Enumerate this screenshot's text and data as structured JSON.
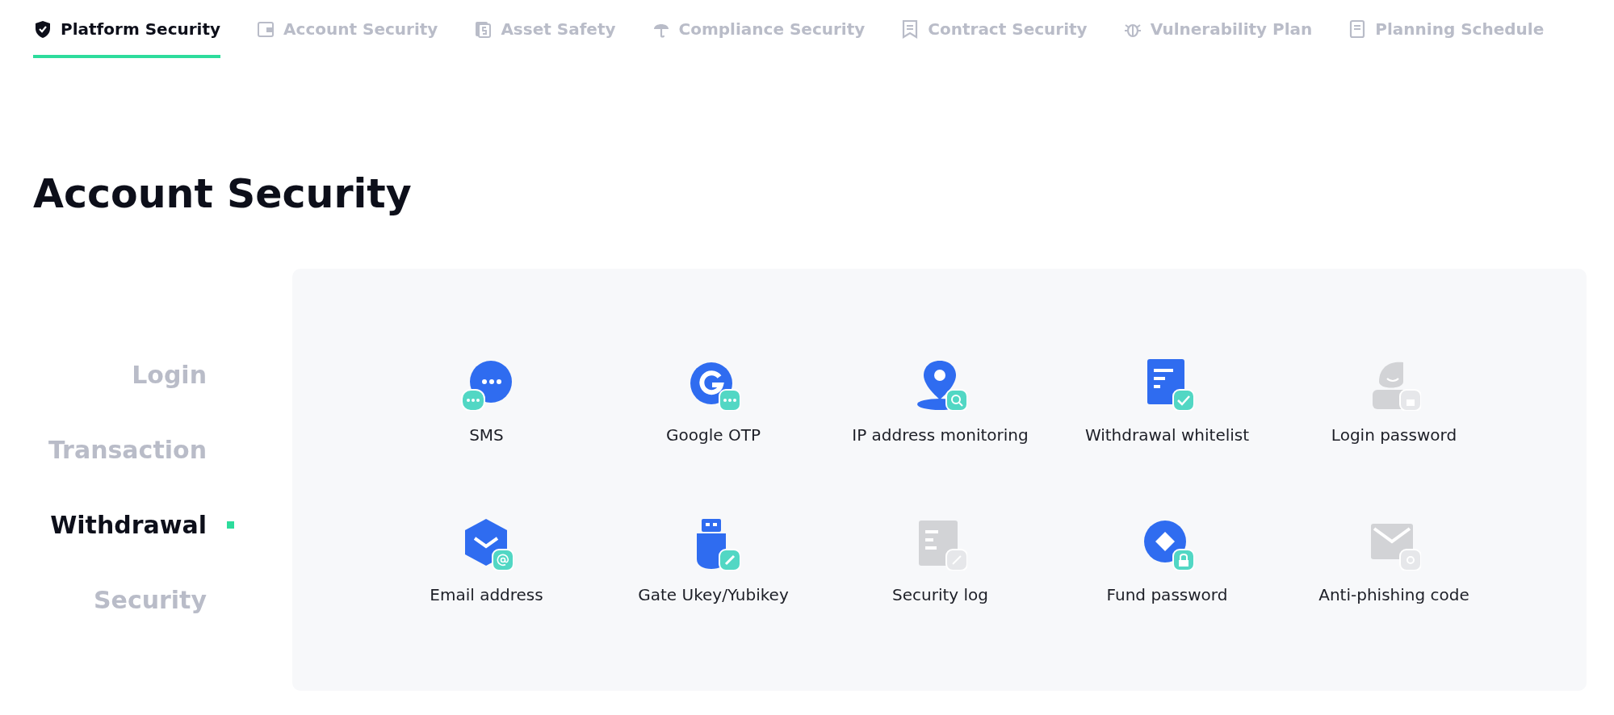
{
  "tabs": [
    {
      "label": "Platform Security",
      "kind": "shield",
      "selected": true
    },
    {
      "label": "Account Security",
      "kind": "wallet",
      "selected": false
    },
    {
      "label": "Asset Safety",
      "kind": "dollar",
      "selected": false
    },
    {
      "label": "Compliance Security",
      "kind": "umbrella",
      "selected": false
    },
    {
      "label": "Contract Security",
      "kind": "receipt",
      "selected": false
    },
    {
      "label": "Vulnerability Plan",
      "kind": "bug",
      "selected": false
    },
    {
      "label": "Planning Schedule",
      "kind": "doc",
      "selected": false
    }
  ],
  "heading": "Account Security",
  "sidebar": {
    "items": [
      {
        "label": "Login",
        "selected": false
      },
      {
        "label": "Transaction",
        "selected": false
      },
      {
        "label": "Withdrawal",
        "selected": true
      },
      {
        "label": "Security",
        "selected": false
      }
    ]
  },
  "features": [
    {
      "label": "SMS",
      "kind": "chat",
      "enabled": true
    },
    {
      "label": "Google OTP",
      "kind": "google",
      "enabled": true
    },
    {
      "label": "IP address monitoring",
      "kind": "pin",
      "enabled": true
    },
    {
      "label": "Withdrawal whitelist",
      "kind": "list",
      "enabled": true
    },
    {
      "label": "Login password",
      "kind": "user",
      "enabled": false
    },
    {
      "label": "Email address",
      "kind": "mail-hex",
      "enabled": true
    },
    {
      "label": "Gate Ukey/Yubikey",
      "kind": "usb",
      "enabled": true
    },
    {
      "label": "Security log",
      "kind": "log",
      "enabled": false
    },
    {
      "label": "Fund password",
      "kind": "diamond",
      "enabled": true
    },
    {
      "label": "Anti-phishing code",
      "kind": "envelope",
      "enabled": false
    }
  ]
}
